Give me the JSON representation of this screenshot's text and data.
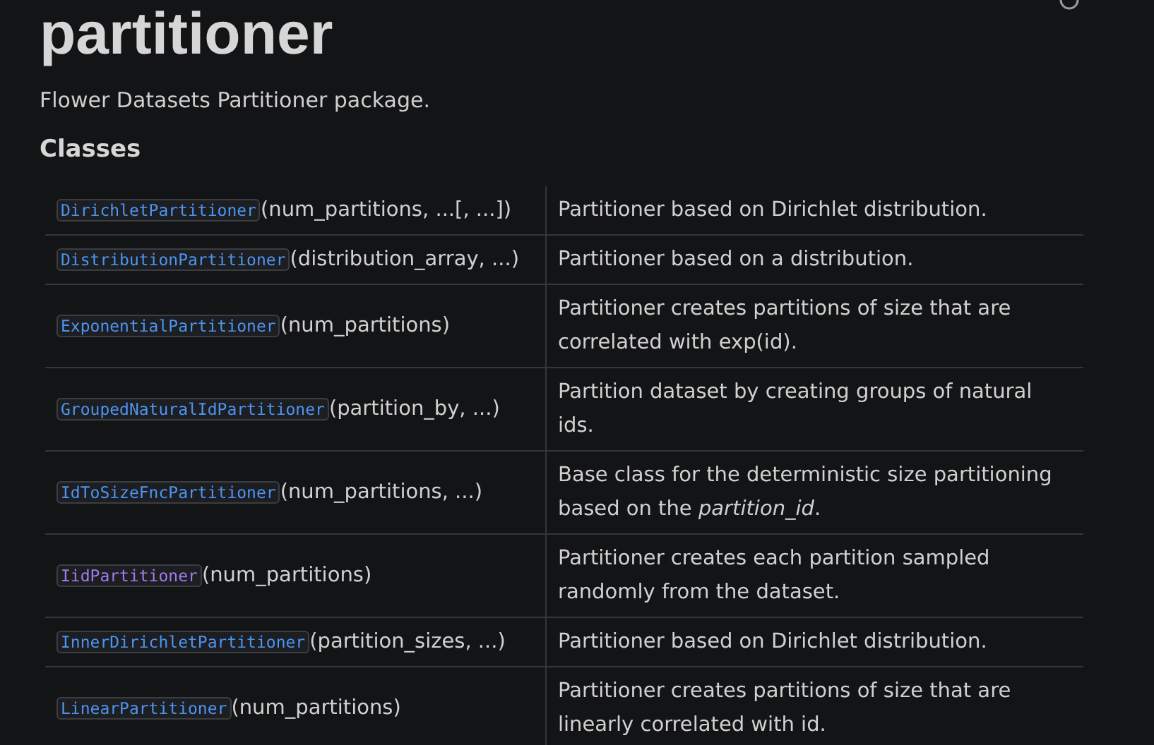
{
  "title": "partitioner",
  "description": "Flower Datasets Partitioner package.",
  "section_heading": "Classes",
  "classes": [
    {
      "name": "DirichletPartitioner",
      "signature": "(num_partitions, ...[, ...])",
      "visited": false,
      "summary": "Partitioner based on Dirichlet distribution."
    },
    {
      "name": "DistributionPartitioner",
      "signature": "(distribution_array, ...)",
      "visited": false,
      "summary": "Partitioner based on a distribution."
    },
    {
      "name": "ExponentialPartitioner",
      "signature": "(num_partitions)",
      "visited": false,
      "summary": "Partitioner creates partitions of size that are correlated with exp(id)."
    },
    {
      "name": "GroupedNaturalIdPartitioner",
      "signature": "(partition_by, ...)",
      "visited": false,
      "summary": "Partition dataset by creating groups of natural ids."
    },
    {
      "name": "IdToSizeFncPartitioner",
      "signature": "(num_partitions, ...)",
      "visited": false,
      "summary": "Base class for the deterministic size partitioning based on the *partition_id*."
    },
    {
      "name": "IidPartitioner",
      "signature": "(num_partitions)",
      "visited": true,
      "summary": "Partitioner creates each partition sampled randomly from the dataset."
    },
    {
      "name": "InnerDirichletPartitioner",
      "signature": "(partition_sizes, ...)",
      "visited": false,
      "summary": "Partitioner based on Dirichlet distribution."
    },
    {
      "name": "LinearPartitioner",
      "signature": "(num_partitions)",
      "visited": false,
      "summary": "Partitioner creates partitions of size that are linearly correlated with id."
    }
  ]
}
